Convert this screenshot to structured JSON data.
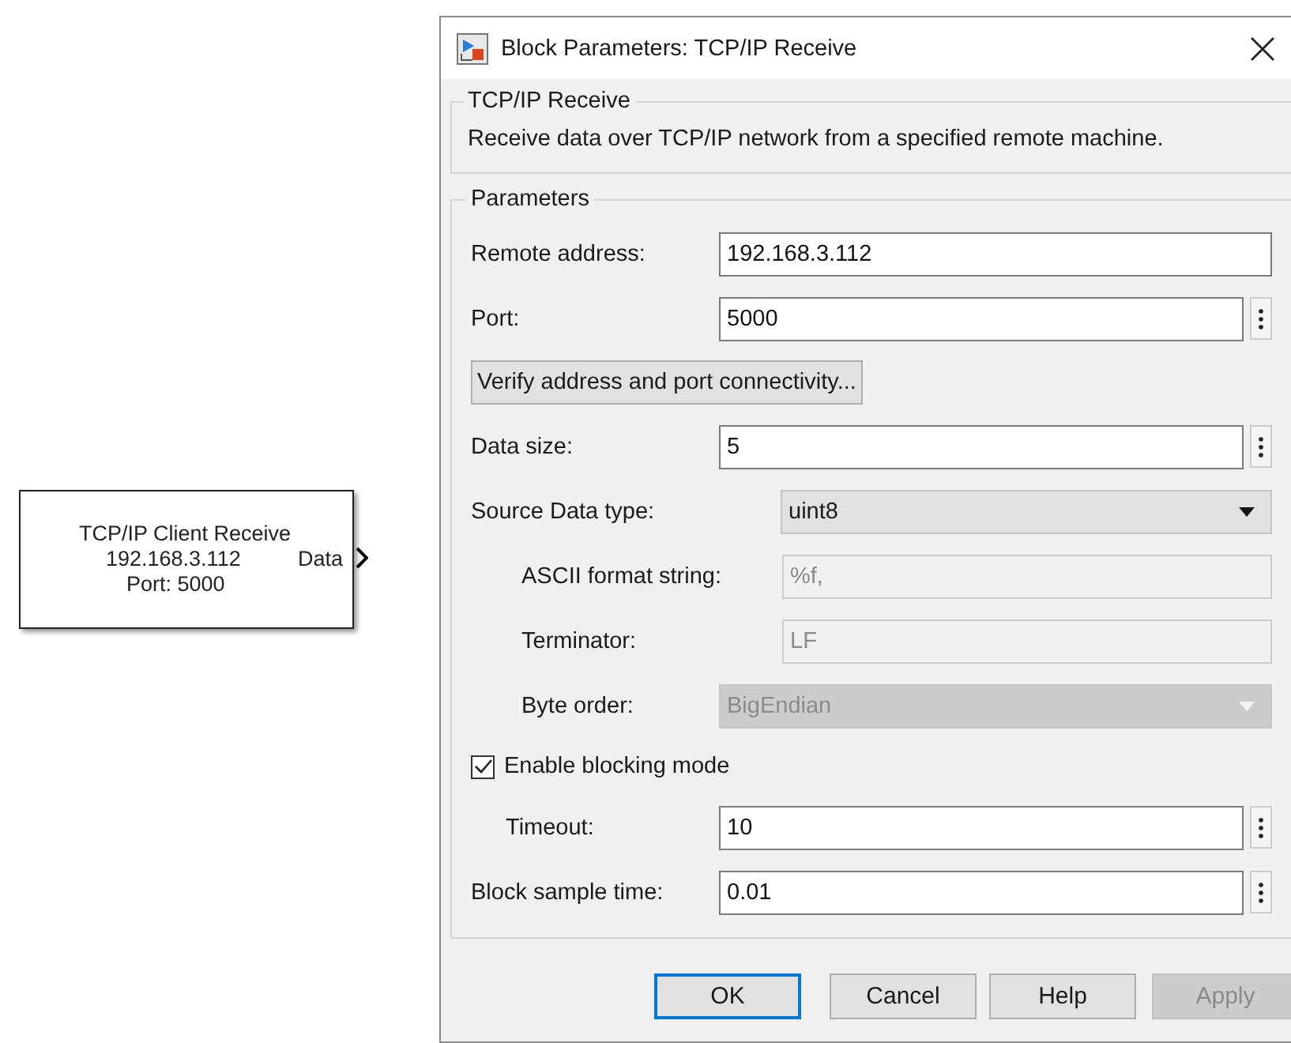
{
  "canvas_block": {
    "title": "TCP/IP Client Receive",
    "address": "192.168.3.112",
    "port_label": "Data",
    "port": "Port: 5000"
  },
  "dialog": {
    "title": "Block Parameters: TCP/IP Receive",
    "description_group": {
      "title": "TCP/IP Receive",
      "text": "Receive data over TCP/IP network from a specified remote machine."
    },
    "parameters_group": {
      "title": "Parameters",
      "items": [
        {
          "kind": "text",
          "label": "Remote address:",
          "value": "192.168.3.112",
          "disabled": false,
          "menu": false
        },
        {
          "kind": "text",
          "label": "Port:",
          "value": "5000",
          "disabled": false,
          "menu": true
        },
        {
          "kind": "button",
          "label": "Verify address and port connectivity...",
          "disabled": false
        },
        {
          "kind": "text",
          "label": "Data size:",
          "value": "5",
          "disabled": false,
          "menu": true
        },
        {
          "kind": "popup",
          "label": "Source Data type:",
          "value": "uint8",
          "disabled": false,
          "children": [
            {
              "kind": "text",
              "label": "ASCII format string:",
              "value": "%f,",
              "disabled": true,
              "menu": false
            },
            {
              "kind": "text",
              "label": "Terminator:",
              "value": "LF",
              "disabled": true,
              "menu": false
            },
            {
              "kind": "popup",
              "label": "Byte order:",
              "value": "BigEndian",
              "disabled": true
            }
          ]
        },
        {
          "kind": "checkbox",
          "label": "Enable blocking mode",
          "checked": true,
          "disabled": false,
          "children": [
            {
              "kind": "text",
              "label": "Timeout:",
              "value": "10",
              "disabled": false,
              "menu": true
            }
          ]
        },
        {
          "kind": "text",
          "label": "Block sample time:",
          "value": "0.01",
          "disabled": false,
          "menu": true
        }
      ]
    },
    "buttons": [
      {
        "label": "OK",
        "default": true,
        "disabled": false
      },
      {
        "label": "Cancel",
        "default": false,
        "disabled": false
      },
      {
        "label": "Help",
        "default": false,
        "disabled": false
      },
      {
        "label": "Apply",
        "default": false,
        "disabled": true
      }
    ]
  }
}
